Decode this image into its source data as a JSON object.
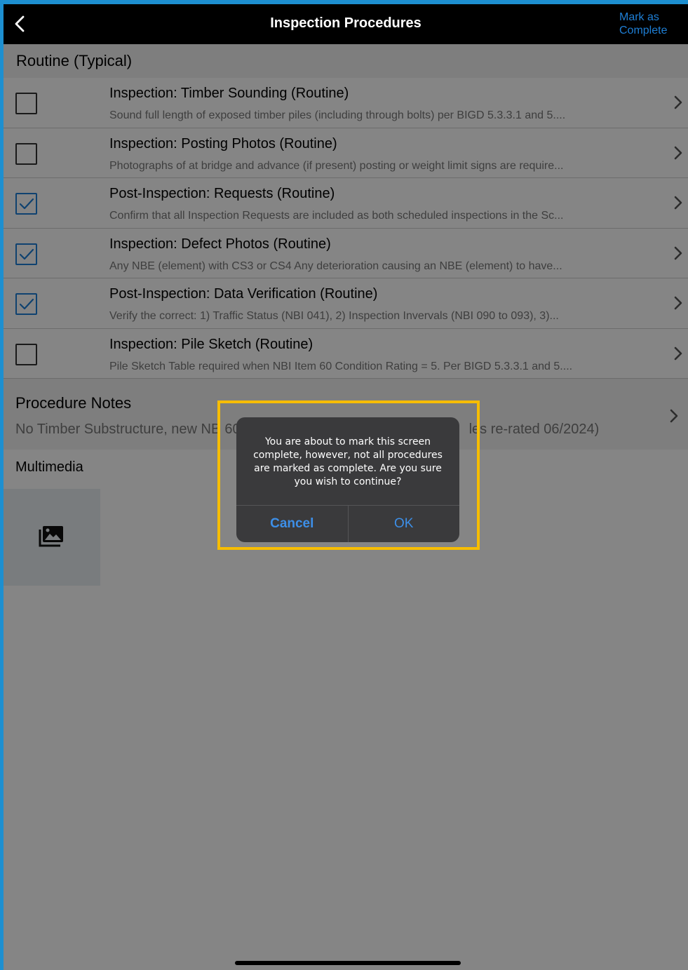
{
  "nav": {
    "title": "Inspection Procedures",
    "mark_complete_label": "Mark as Complete"
  },
  "section": {
    "title": "Routine (Typical)"
  },
  "procedures": [
    {
      "title": "Inspection: Timber Sounding (Routine)",
      "description": "Sound full length of exposed timber piles (including through bolts) per BIGD 5.3.3.1 and 5....",
      "checked": false
    },
    {
      "title": "Inspection: Posting Photos (Routine)",
      "description": "Photographs of at bridge and advance (if present) posting or weight limit signs are require...",
      "checked": false
    },
    {
      "title": "Post-Inspection: Requests (Routine)",
      "description": "Confirm that all Inspection Requests are included as both scheduled inspections in the Sc...",
      "checked": true
    },
    {
      "title": "Inspection: Defect Photos (Routine)",
      "description": "Any NBE (element) with CS3 or CS4 Any deterioration causing an NBE (element) to have...",
      "checked": true
    },
    {
      "title": "Post-Inspection: Data Verification (Routine)",
      "description": "Verify the correct: 1) Traffic Status (NBI 041), 2) Inspection Invervals (NBI 090 to 093), 3)...",
      "checked": true
    },
    {
      "title": "Inspection: Pile Sketch (Routine)",
      "description": "Pile Sketch Table required when NBI Item 60 Condition Rating = 5. Per BIGD 5.3.3.1 and 5....",
      "checked": false
    }
  ],
  "notes": {
    "title": "Procedure Notes",
    "text_visible_left": "No Timber Substructure, new NB",
    "text_visible_mid": "60",
    "text_visible_right": "les re-rated 06/2024)"
  },
  "multimedia": {
    "title": "Multimedia"
  },
  "icons": {
    "back": "chevron-left-icon",
    "row_disclosure": "chevron-right-icon",
    "media": "photo-library-icon",
    "check": "checkmark-icon"
  },
  "alert": {
    "message": "You are about to mark this screen complete, however, not all procedures are marked as complete. Are you sure you wish to continue?",
    "cancel_label": "Cancel",
    "ok_label": "OK"
  },
  "colors": {
    "accent": "#1e7fd6",
    "navbar": "#000000",
    "highlight": "#f7bd00",
    "alert_bg": "#3a3a3c"
  }
}
